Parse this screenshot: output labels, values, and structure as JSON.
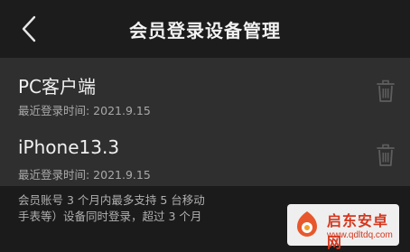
{
  "header": {
    "back_icon": "chevron-left-icon",
    "title": "会员登录设备管理"
  },
  "devices": [
    {
      "name": "PC客户端",
      "last_login": "最近登录时间: 2021.9.15",
      "delete_icon": "trash-icon"
    },
    {
      "name": "iPhone13.3",
      "last_login": "最近登录时间: 2021.9.15",
      "delete_icon": "trash-icon"
    }
  ],
  "note": {
    "line1": "会员账号 3 个月内最多支持 5 台移动",
    "line2": "手表等）设备同时登录，超过 3 个月"
  },
  "watermark": {
    "title": "启东安卓网",
    "url": "www.qdltdq.com"
  },
  "colors": {
    "background": "#1b1b1b",
    "list_background": "#2f2f2f",
    "watermark_accent": "#d4371e"
  }
}
